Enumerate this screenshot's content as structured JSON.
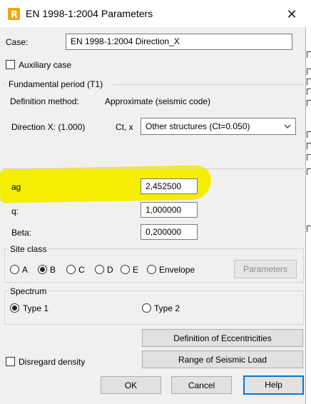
{
  "window": {
    "title": "EN 1998-1:2004 Parameters",
    "close_glyph": "✕",
    "app_icon_letter": "R"
  },
  "case": {
    "label": "Case:",
    "value": "EN 1998-1:2004 Direction_X"
  },
  "auxiliary_case": {
    "label": "Auxiliary case",
    "checked": false
  },
  "fundamental_period": {
    "group_label": "Fundamental period (T1)",
    "definition_method_label": "Definition method:",
    "definition_method_value": "Approximate (seismic code)",
    "direction_label": "Direction X: (1.000)",
    "ct_label": "Ct, x",
    "ct_selected": "Other structures (Ct=0.050)"
  },
  "params": {
    "ag_label": "ag",
    "ag_value": "2,452500",
    "q_label": "q:",
    "q_value": "1,000000",
    "beta_label": "Beta:",
    "beta_value": "0,200000"
  },
  "site_class": {
    "group_label": "Site class",
    "options": [
      "A",
      "B",
      "C",
      "D",
      "E",
      "Envelope"
    ],
    "selected": "B",
    "parameters_button": "Parameters"
  },
  "spectrum": {
    "group_label": "Spectrum",
    "options": [
      "Type 1",
      "Type 2"
    ],
    "selected": "Type 1"
  },
  "buttons": {
    "eccentricities": "Definition of Eccentricities",
    "seismic_load": "Range of Seismic Load",
    "ok": "OK",
    "cancel": "Cancel",
    "help": "Help"
  },
  "disregard_density": {
    "label": "Disregard density",
    "checked": false
  },
  "colors": {
    "highlight": "#f5ee00",
    "accent": "#0078d7",
    "app_icon": "#f0a800"
  }
}
